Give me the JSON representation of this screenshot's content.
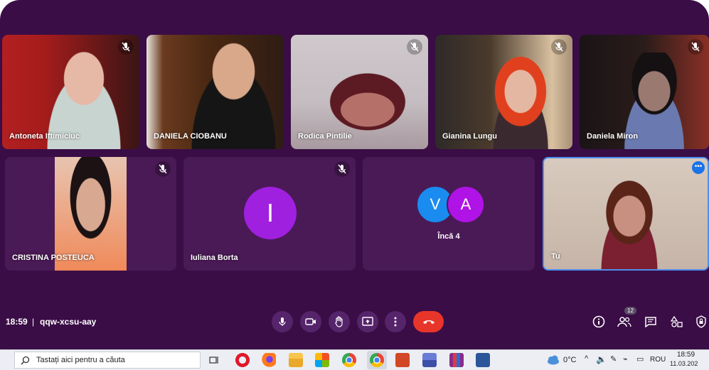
{
  "participants": [
    {
      "name": "Antoneta Iftimiciuc",
      "muted": true
    },
    {
      "name": "DANIELA CIOBANU",
      "muted": false
    },
    {
      "name": "Rodica Pintilie",
      "muted": true
    },
    {
      "name": "Gianina Lungu",
      "muted": true
    },
    {
      "name": "Daniela Miron",
      "muted": true
    },
    {
      "name": "CRISTINA POSTEUCA",
      "muted": true
    },
    {
      "name": "Iuliana Borta",
      "muted": true,
      "avatar_letter": "I",
      "avatar_color": "#a020e0"
    },
    {
      "name": "Tu",
      "muted": false
    }
  ],
  "more_tile": {
    "avatars": [
      {
        "letter": "V",
        "color": "#1a8cf0"
      },
      {
        "letter": "A",
        "color": "#b013e6"
      }
    ],
    "label": "Încă 4"
  },
  "meeting": {
    "time": "18:59",
    "code": "qqw-xcsu-aay",
    "people_count": "12"
  },
  "controls": {
    "mic": "microphone-icon",
    "camera": "camera-icon",
    "raise_hand": "hand-icon",
    "present": "present-screen-icon",
    "more": "more-vert-icon",
    "end_call": "phone-hangup-icon"
  },
  "taskbar": {
    "search_placeholder": "Tastați aici pentru a căuta",
    "weather": "0°C",
    "language": "ROU",
    "clock_time": "18:59",
    "clock_date": "11.03.202"
  },
  "colors": {
    "background": "#3a0d46",
    "tile": "#4a1a56",
    "control_button": "#56246a",
    "hangup": "#e8352a",
    "active_border": "#4d8ff0"
  }
}
